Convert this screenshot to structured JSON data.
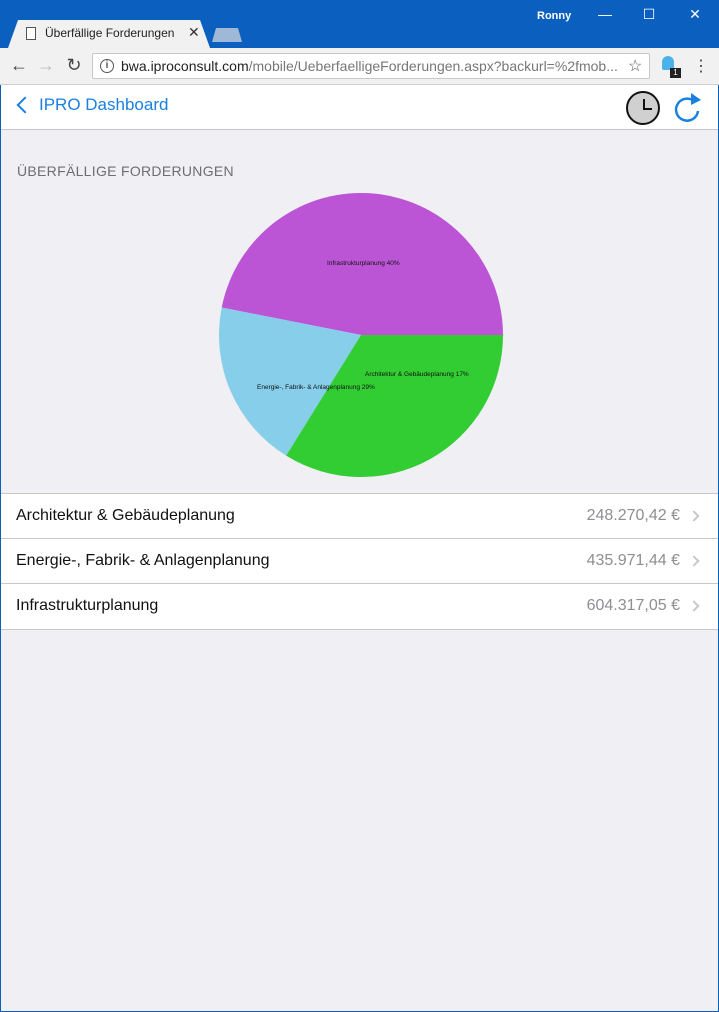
{
  "browser": {
    "tab_title": "Überfällige Forderungen",
    "profile_name": "Ronny",
    "url_host": "bwa.iproconsult.com",
    "url_path": "/mobile/UeberfaelligeForderungen.aspx?backurl=%2fmob...",
    "extension_badge": "1"
  },
  "appbar": {
    "back_label": "IPRO Dashboard"
  },
  "section_title": "ÜBERFÄLLIGE FORDERUNGEN",
  "chart_data": {
    "type": "pie",
    "slices": [
      {
        "label": "Infrastrukturplanung",
        "percent_label": "Infrastrukturplanung 40%",
        "value": 604317.05,
        "color": "#bb55d6"
      },
      {
        "label": "Architektur & Gebäudeplanung",
        "percent_label": "Architektur & Gebäudeplanung 17%",
        "value": 248270.42,
        "color": "#87ceeb"
      },
      {
        "label": "Energie-, Fabrik- & Anlagenplanung",
        "percent_label": "Energie-, Fabrik- & Anlagenplanung 29%",
        "value": 435971.44,
        "color": "#32cd32"
      }
    ]
  },
  "list": [
    {
      "label": "Architektur & Gebäudeplanung",
      "value": "248.270,42 €"
    },
    {
      "label": "Energie-, Fabrik- & Anlagenplanung",
      "value": "435.971,44 €"
    },
    {
      "label": "Infrastrukturplanung",
      "value": "604.317,05 €"
    }
  ]
}
